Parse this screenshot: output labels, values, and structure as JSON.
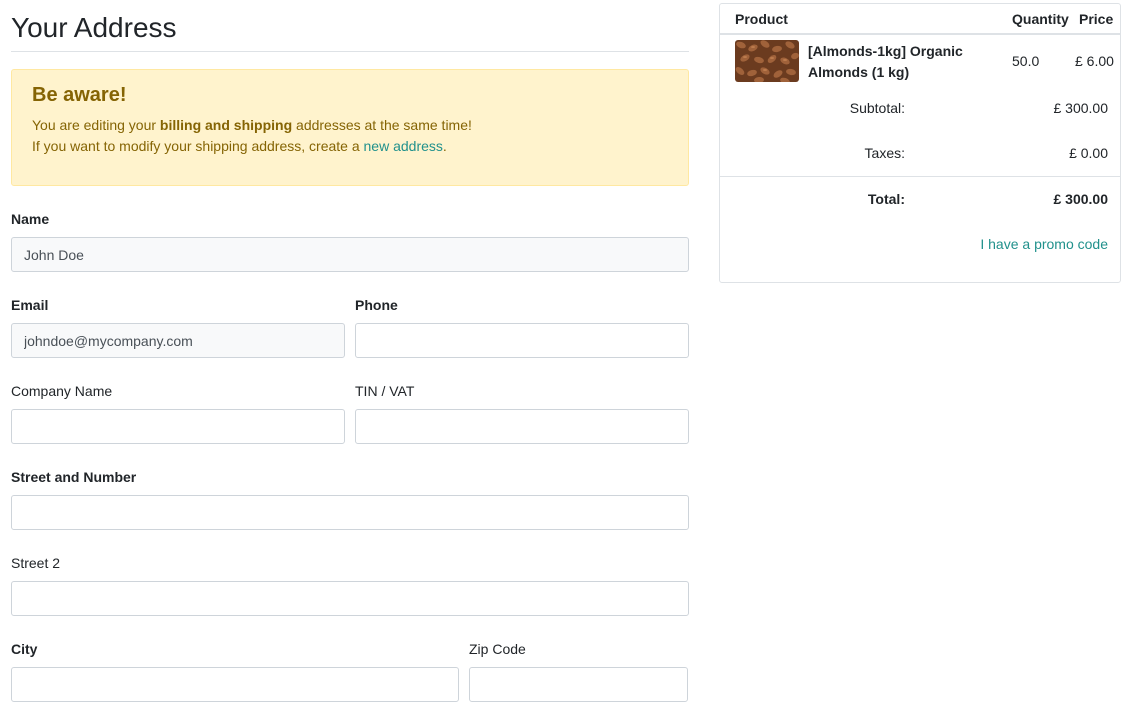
{
  "page": {
    "title": "Your Address"
  },
  "alert": {
    "title": "Be aware!",
    "line1_before": "You are editing your ",
    "line1_bold": "billing and shipping",
    "line1_after": " addresses at the same time!",
    "line2_before": "If you want to modify your shipping address, create a ",
    "line2_link": "new address",
    "line2_after": "."
  },
  "form": {
    "name": {
      "label": "Name",
      "value": "John Doe"
    },
    "email": {
      "label": "Email",
      "value": "johndoe@mycompany.com"
    },
    "phone": {
      "label": "Phone",
      "value": ""
    },
    "company": {
      "label": "Company Name",
      "value": ""
    },
    "vat": {
      "label": "TIN / VAT",
      "value": ""
    },
    "street": {
      "label": "Street and Number",
      "value": ""
    },
    "street2": {
      "label": "Street 2",
      "value": ""
    },
    "city": {
      "label": "City",
      "value": ""
    },
    "zip": {
      "label": "Zip Code",
      "value": ""
    }
  },
  "cart": {
    "headers": {
      "product": "Product",
      "quantity": "Quantity",
      "price": "Price"
    },
    "item": {
      "name": "[Almonds-1kg] Organic Almonds (1 kg)",
      "quantity": "50.0",
      "price": "£ 6.00",
      "image_icon": "almonds-image"
    },
    "subtotal": {
      "label": "Subtotal:",
      "value": "£ 300.00"
    },
    "taxes": {
      "label": "Taxes:",
      "value": "£ 0.00"
    },
    "total": {
      "label": "Total:",
      "value": "£ 300.00"
    },
    "promo_label": "I have a promo code"
  },
  "colors": {
    "link": "#21918c",
    "alert_bg": "#fff3cd",
    "alert_text": "#856404"
  }
}
